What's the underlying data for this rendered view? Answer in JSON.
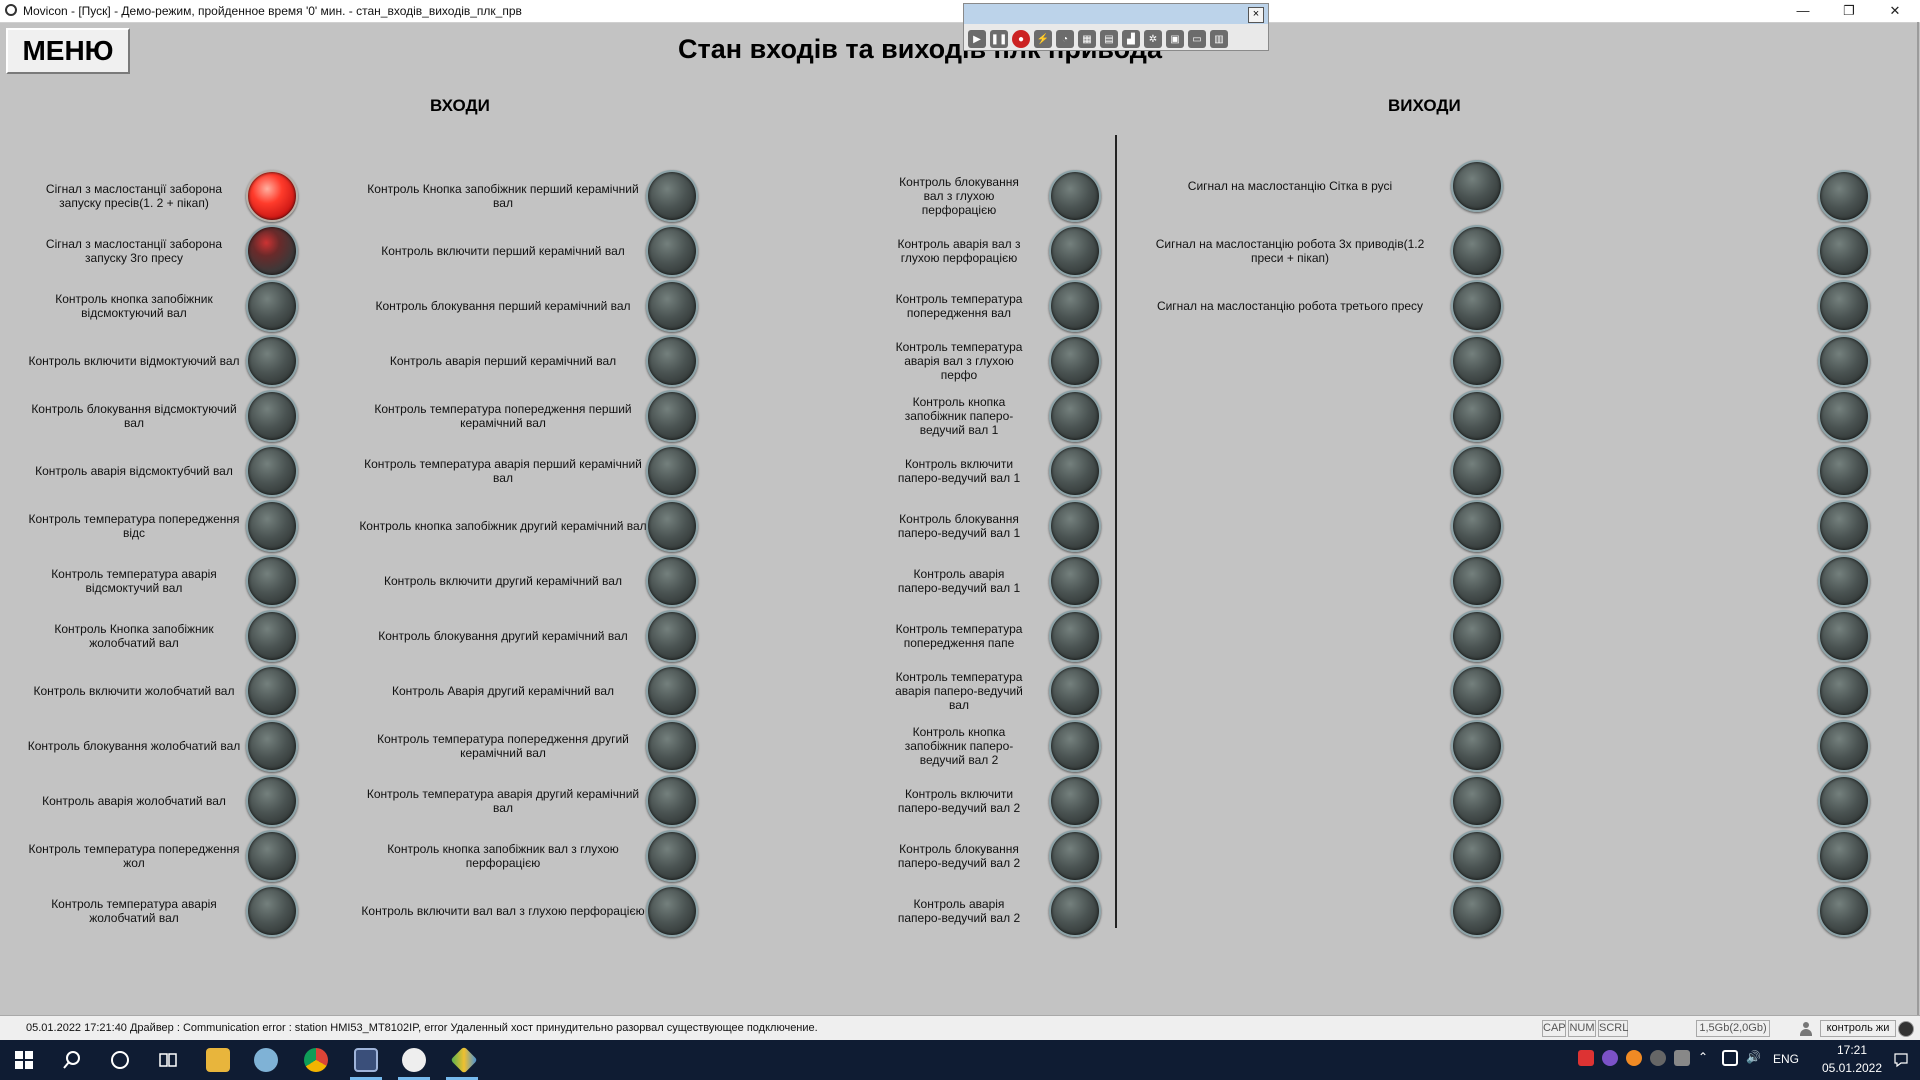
{
  "window": {
    "title": "Movicon - [Пуск] - Демо-режим, пройденное время '0' мин. - стан_входів_виходів_плк_прв",
    "minimize": "—",
    "restore": "❐",
    "close": "✕"
  },
  "runtime_toolbar": {
    "close": "×",
    "tools": [
      "play-icon",
      "pause-icon",
      "record-icon",
      "lightning-icon",
      "clock-icon",
      "table-icon",
      "document-icon",
      "chart-icon",
      "gear-icon",
      "save-icon",
      "monitor-icon",
      "trash-icon"
    ]
  },
  "screen": {
    "menu_button": "МЕНЮ",
    "title": "Стан входів та виходів плк привода",
    "inputs_header": "ВХОДИ",
    "outputs_header": "ВИХОДИ"
  },
  "inputs_col1": [
    {
      "label": "Сігнал з маслостанції заборона запуску пресів(1. 2 + пікап)",
      "state": "on"
    },
    {
      "label": "Сігнал з маслостанції заборона запуску 3го пресу",
      "state": "dim"
    },
    {
      "label": "Контроль кнопка запобіжник відсмоктуючий вал",
      "state": "off"
    },
    {
      "label": "Контроль включити відмоктуючий вал",
      "state": "off"
    },
    {
      "label": "Контроль блокування відсмоктуючий вал",
      "state": "off"
    },
    {
      "label": "Контроль аварія відсмоктубчий вал",
      "state": "off"
    },
    {
      "label": "Контроль температура попередження відс",
      "state": "off"
    },
    {
      "label": "Контроль температура аварія відсмоктучий вал",
      "state": "off"
    },
    {
      "label": "Контроль Кнопка запобіжник жолобчатий вал",
      "state": "off"
    },
    {
      "label": "Контроль включити жолобчатий вал",
      "state": "off"
    },
    {
      "label": "Контроль блокування жолобчатий вал",
      "state": "off"
    },
    {
      "label": "Контроль аварія жолобчатий вал",
      "state": "off"
    },
    {
      "label": "Контроль температура попередження жол",
      "state": "off"
    },
    {
      "label": "Контроль температура аварія жолобчатий вал",
      "state": "off"
    }
  ],
  "inputs_col2": [
    {
      "label": "Контроль Кнопка запобіжник перший керамічний вал",
      "state": "off"
    },
    {
      "label": "Контроль включити перший керамічний вал",
      "state": "off"
    },
    {
      "label": "Контроль блокування перший керамічний вал",
      "state": "off"
    },
    {
      "label": "Контроль аварія перший керамічний вал",
      "state": "off"
    },
    {
      "label": "Контроль температура попередження перший керамічний вал",
      "state": "off"
    },
    {
      "label": "Контроль температура аварія перший керамічний вал",
      "state": "off"
    },
    {
      "label": "Контроль кнопка запобіжник другий керамічний вал",
      "state": "off"
    },
    {
      "label": "Контроль включити другий керамічний вал",
      "state": "off"
    },
    {
      "label": "Контроль блокування другий керамічний вал",
      "state": "off"
    },
    {
      "label": "Контроль Аварія другий керамічний вал",
      "state": "off"
    },
    {
      "label": "Контроль температура попередження другий керамічний вал",
      "state": "off"
    },
    {
      "label": "Контроль температура аварія другий керамічний вал",
      "state": "off"
    },
    {
      "label": "Контроль кнопка запобіжник вал з глухою перфорацією",
      "state": "off"
    },
    {
      "label": "Контроль включити вал вал з глухою перфорацією",
      "state": "off"
    }
  ],
  "inputs_col3": [
    {
      "label": "Контроль блокування вал з глухою перфорацією",
      "state": "off"
    },
    {
      "label": "Контроль аварія вал з глухою перфорацією",
      "state": "off"
    },
    {
      "label": "Контроль температура попередження вал",
      "state": "off"
    },
    {
      "label": "Контроль температура аварія вал з глухою перфо",
      "state": "off"
    },
    {
      "label": "Контроль кнопка запобіжник паперо-ведучий вал 1",
      "state": "off"
    },
    {
      "label": "Контроль включити паперо-ведучий вал 1",
      "state": "off"
    },
    {
      "label": "Контроль блокування паперо-ведучий вал 1",
      "state": "off"
    },
    {
      "label": "Контроль аварія паперо-ведучий вал 1",
      "state": "off"
    },
    {
      "label": "Контроль температура попередження папе",
      "state": "off"
    },
    {
      "label": "Контроль температура аварія паперо-ведучий вал",
      "state": "off"
    },
    {
      "label": "Контроль кнопка запобіжник паперо-ведучий вал 2",
      "state": "off"
    },
    {
      "label": "Контроль включити паперо-ведучий вал 2",
      "state": "off"
    },
    {
      "label": "Контроль блокування паперо-ведучий вал 2",
      "state": "off"
    },
    {
      "label": "Контроль аварія паперо-ведучий вал 2",
      "state": "off"
    }
  ],
  "outputs_col1": [
    {
      "label": "Сигнал на маслостанцію Сітка в русі",
      "state": "off"
    },
    {
      "label": "Сигнал на маслостанцію робота 3х приводів(1.2 преси + пікап)",
      "state": "off"
    },
    {
      "label": "Сигнал на маслостанцію робота третього пресу",
      "state": "off"
    },
    {
      "label": "",
      "state": "off"
    },
    {
      "label": "",
      "state": "off"
    },
    {
      "label": "",
      "state": "off"
    },
    {
      "label": "",
      "state": "off"
    },
    {
      "label": "",
      "state": "off"
    },
    {
      "label": "",
      "state": "off"
    },
    {
      "label": "",
      "state": "off"
    },
    {
      "label": "",
      "state": "off"
    },
    {
      "label": "",
      "state": "off"
    },
    {
      "label": "",
      "state": "off"
    },
    {
      "label": "",
      "state": "off"
    }
  ],
  "outputs_col2": [
    {
      "state": "off"
    },
    {
      "state": "off"
    },
    {
      "state": "off"
    },
    {
      "state": "off"
    },
    {
      "state": "off"
    },
    {
      "state": "off"
    },
    {
      "state": "off"
    },
    {
      "state": "off"
    },
    {
      "state": "off"
    },
    {
      "state": "off"
    },
    {
      "state": "off"
    },
    {
      "state": "off"
    },
    {
      "state": "off"
    },
    {
      "state": "off"
    }
  ],
  "statusbar": {
    "message": "05.01.2022 17:21:40 Драйвер : Communication error : station HMI53_MT8102IP, error Удаленный хост принудительно разорвал существующее подключение.",
    "cap": "CAP",
    "num": "NUM",
    "scrl": "SCRL",
    "memory": "1,5Gb(2,0Gb)",
    "user": "контроль жи"
  },
  "taskbar": {
    "language": "ENG",
    "time": "17:21",
    "date": "05.01.2022"
  }
}
